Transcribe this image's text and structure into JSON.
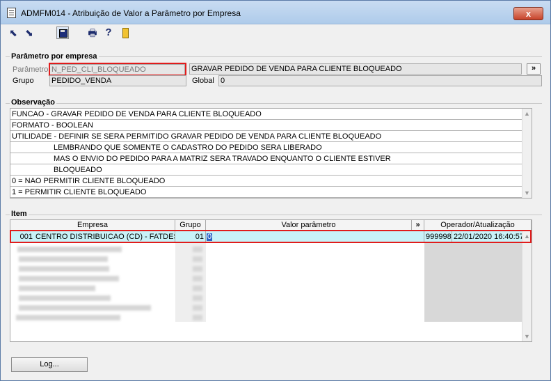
{
  "window": {
    "title": "ADMFM014 - Atribuição de Valor a Parâmetro por Empresa",
    "close_label": "x"
  },
  "toolbar": {
    "icons": [
      "expand-icon",
      "collapse-icon",
      "save-icon",
      "print-icon",
      "help-icon",
      "exit-icon"
    ],
    "print_glyph": "🖶",
    "help_glyph": "?",
    "expand_glyph": "⬉",
    "collapse_glyph": "⬊"
  },
  "param_section": {
    "title": "Parâmetro por empresa",
    "parametro_label": "Parâmetro",
    "parametro_value": "N_PED_CLI_BLOQUEADO",
    "descricao_value": "GRAVAR PEDIDO DE VENDA PARA CLIENTE BLOQUEADO",
    "more_label": "»",
    "grupo_label": "Grupo",
    "grupo_value": "PEDIDO_VENDA",
    "global_label": "Global",
    "global_value": "0"
  },
  "obs_section": {
    "title": "Observação",
    "lines": [
      "FUNCAO - GRAVAR PEDIDO DE VENDA PARA CLIENTE BLOQUEADO",
      "FORMATO - BOOLEAN",
      "UTILIDADE - DEFINIR SE SERA PERMITIDO GRAVAR PEDIDO DE VENDA PARA CLIENTE BLOQUEADO",
      "LEMBRANDO QUE SOMENTE O CADASTRO DO PEDIDO SERA LIBERADO",
      "MAS O ENVIO DO PEDIDO PARA A MATRIZ SERA TRAVADO ENQUANTO O CLIENTE ESTIVER",
      "BLOQUEADO",
      "0 = NAO PERMITIR CLIENTE BLOQUEADO",
      "1 = PERMITIR CLIENTE BLOQUEADO"
    ]
  },
  "item_section": {
    "title": "Item",
    "columns": {
      "empresa": "Empresa",
      "grupo": "Grupo",
      "valor": "Valor parâmetro",
      "more": "»",
      "operador": "Operador/Atualização"
    },
    "selected_row": {
      "codigo": "001",
      "empresa": "CENTRO DISTRIBUICAO (CD) - FATDES",
      "grupo": "01",
      "valor": "0",
      "operador": "999998",
      "atualizacao": "22/01/2020 16:40:57"
    }
  },
  "footer": {
    "log_button": "Log..."
  },
  "colors": {
    "highlight": "#e11c1c",
    "selected_row": "#c8f2f8"
  }
}
